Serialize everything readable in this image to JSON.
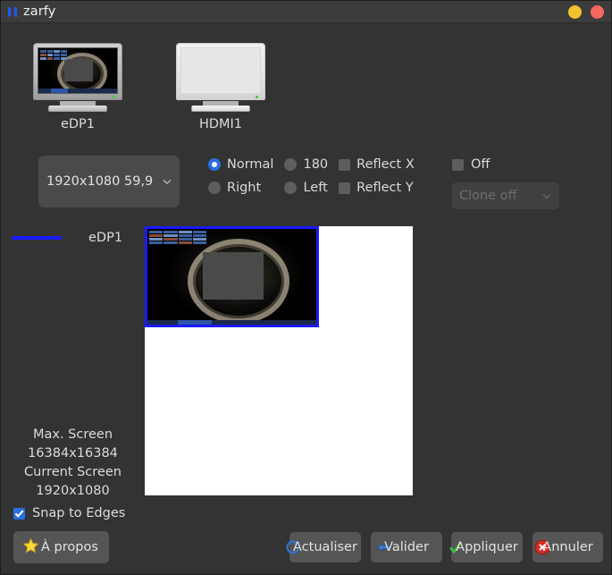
{
  "window": {
    "title": "zarfy",
    "app_icon": "zarfy-logo-icon",
    "buttons": {
      "minimize": "minimize-button",
      "close": "close-button"
    }
  },
  "monitors": [
    {
      "label": "eDP1",
      "state": "on",
      "icon": "monitor-icon"
    },
    {
      "label": "HDMI1",
      "state": "off",
      "icon": "monitor-icon"
    }
  ],
  "resolution": {
    "value": "1920x1080  59,9",
    "chevron": "chevron-down-icon"
  },
  "rotation": {
    "normal": {
      "label": "Normal",
      "checked": true
    },
    "right": {
      "label": "Right",
      "checked": false
    },
    "rot180": {
      "label": "180",
      "checked": false
    },
    "left": {
      "label": "Left",
      "checked": false
    }
  },
  "reflect": {
    "x": {
      "label": "Reflect X",
      "checked": false
    },
    "y": {
      "label": "Reflect Y",
      "checked": false
    }
  },
  "output": {
    "off": {
      "label": "Off",
      "checked": false
    },
    "clone": {
      "value": "Clone off",
      "chevron": "chevron-down-icon"
    }
  },
  "layout": {
    "legend_label": "eDP1",
    "legend_color": "#1a1aff",
    "canvas_background": "#ffffff"
  },
  "info": {
    "max_screen_label": "Max. Screen",
    "max_screen_value": "16384x16384",
    "current_screen_label": "Current Screen",
    "current_screen_value": "1920x1080",
    "snap_to_edges": {
      "label": "Snap to Edges",
      "checked": true
    }
  },
  "footer": {
    "about": {
      "label": "À propos",
      "icon": "star-icon"
    },
    "refresh": {
      "label": "Actualiser",
      "icon": "refresh-icon"
    },
    "validate": {
      "label": "Valider",
      "icon": "arrow-left-icon"
    },
    "apply": {
      "label": "Appliquer",
      "icon": "check-icon"
    },
    "cancel": {
      "label": "Annuler",
      "icon": "stop-x-icon"
    }
  }
}
